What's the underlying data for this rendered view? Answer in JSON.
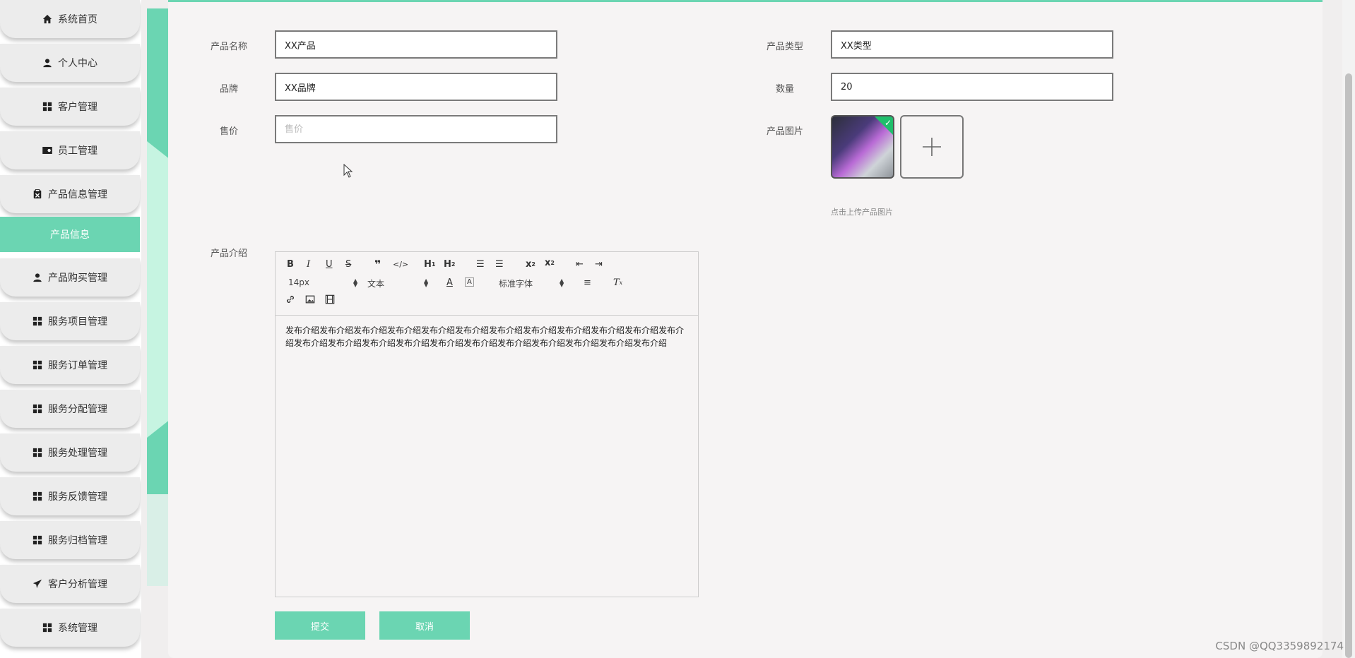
{
  "sidebar": {
    "items": [
      {
        "label": "系统首页",
        "icon": "home-icon"
      },
      {
        "label": "个人中心",
        "icon": "user-icon"
      },
      {
        "label": "客户管理",
        "icon": "grid-icon"
      },
      {
        "label": "员工管理",
        "icon": "id-card-icon"
      },
      {
        "label": "产品信息管理",
        "icon": "clipboard-icon"
      },
      {
        "label": "产品信息",
        "icon": ""
      },
      {
        "label": "产品购买管理",
        "icon": "user-icon"
      },
      {
        "label": "服务项目管理",
        "icon": "grid-icon"
      },
      {
        "label": "服务订单管理",
        "icon": "grid-icon"
      },
      {
        "label": "服务分配管理",
        "icon": "grid-icon"
      },
      {
        "label": "服务处理管理",
        "icon": "grid-icon"
      },
      {
        "label": "服务反馈管理",
        "icon": "grid-icon"
      },
      {
        "label": "服务归档管理",
        "icon": "grid-icon"
      },
      {
        "label": "客户分析管理",
        "icon": "send-icon"
      },
      {
        "label": "系统管理",
        "icon": "grid-icon"
      }
    ]
  },
  "form": {
    "product_name_label": "产品名称",
    "product_name_value": "XX产品",
    "product_type_label": "产品类型",
    "product_type_value": "XX类型",
    "brand_label": "品牌",
    "brand_value": "XX品牌",
    "quantity_label": "数量",
    "quantity_value": "20",
    "price_label": "售价",
    "price_placeholder": "售价",
    "image_label": "产品图片",
    "image_hint": "点击上传产品图片",
    "intro_label": "产品介绍"
  },
  "editor": {
    "font_size": "14px",
    "header_select": "文本",
    "font_family": "标准字体",
    "content": "发布介绍发布介绍发布介绍发布介绍发布介绍发布介绍发布介绍发布介绍发布介绍发布介绍发布介绍发布介绍发布介绍发布介绍发布介绍发布介绍发布介绍发布介绍发布介绍发布介绍发布介绍发布介绍发布介绍"
  },
  "buttons": {
    "submit": "提交",
    "cancel": "取消"
  },
  "watermark": "CSDN @QQ3359892174",
  "colors": {
    "accent": "#6bd5b2"
  }
}
